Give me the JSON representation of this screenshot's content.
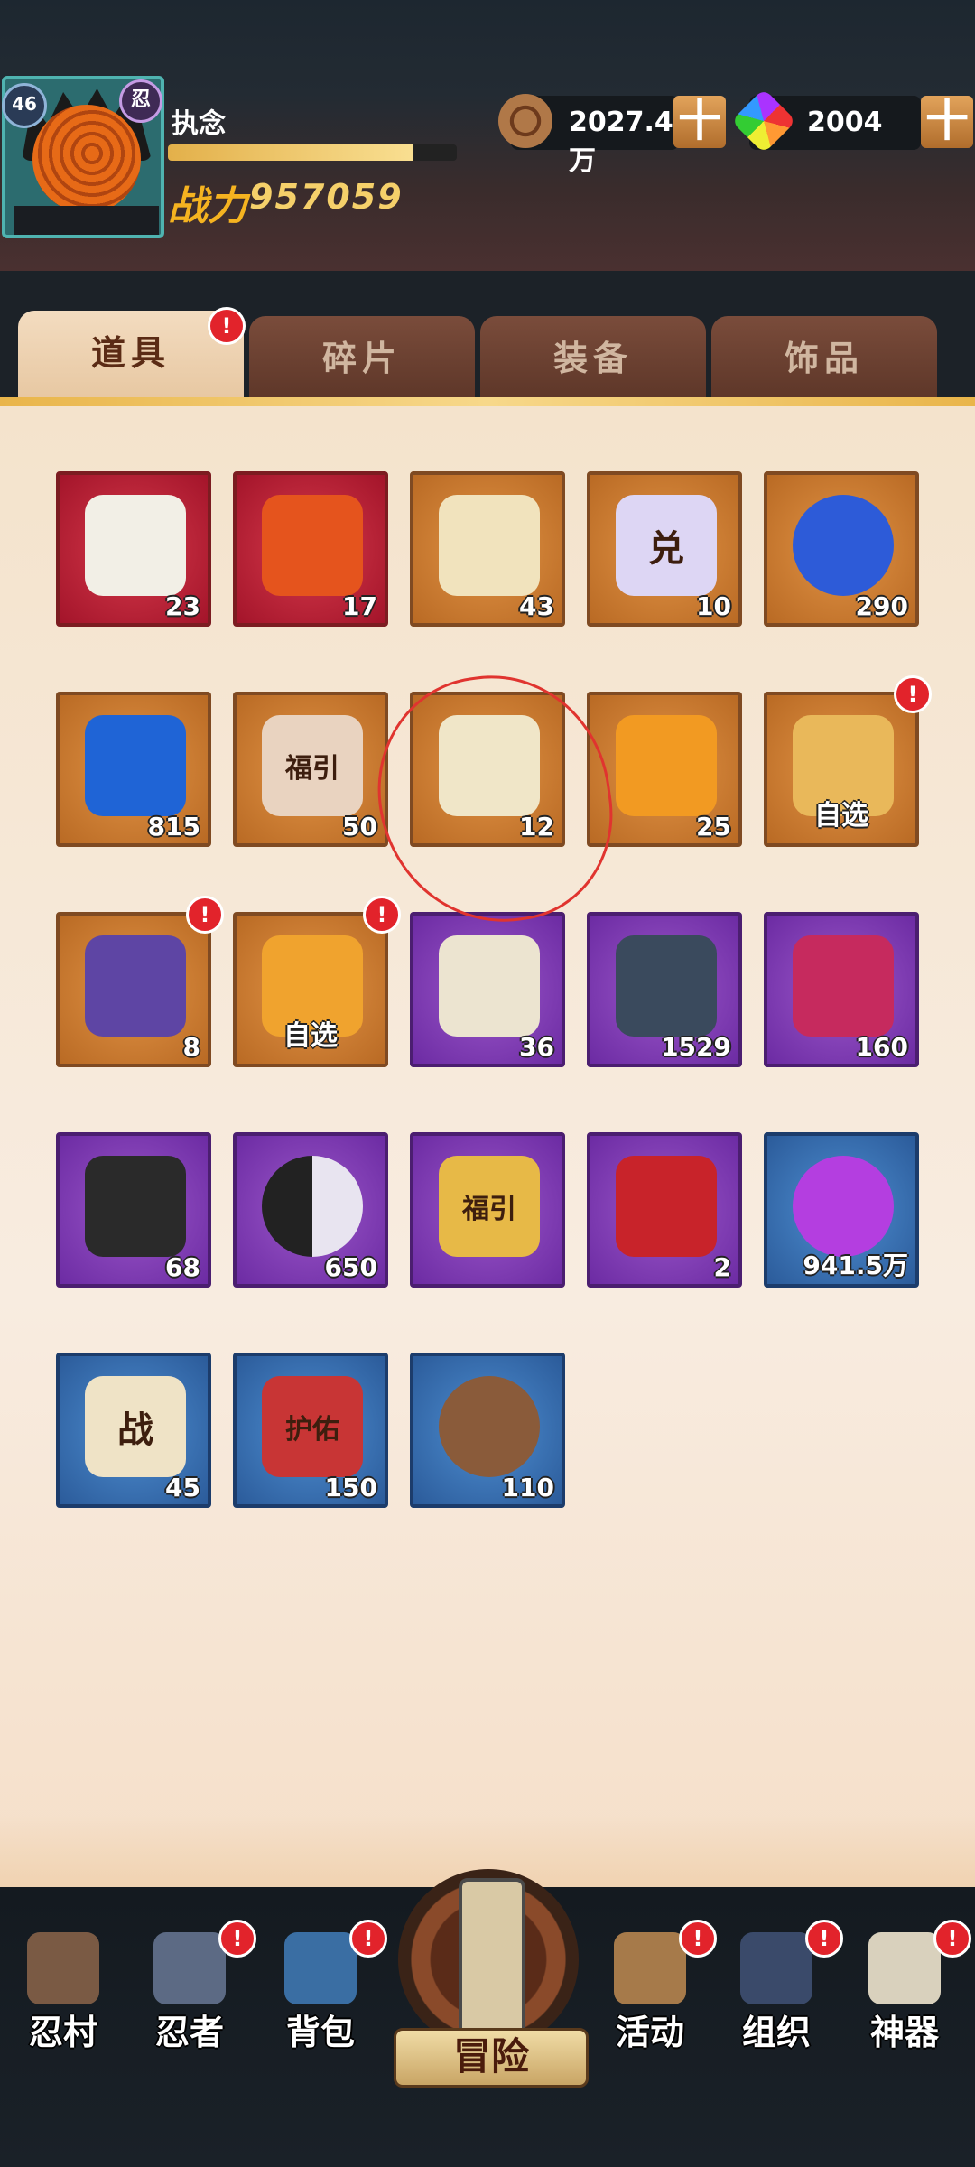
{
  "player": {
    "level": "46",
    "rank_icon": "忍",
    "name": "执念",
    "xp_fraction": 0.85,
    "power_label": "战力",
    "power_value": "957059"
  },
  "currency": {
    "coins": "2027.4万",
    "gems": "2004",
    "plus": "十"
  },
  "tabs": [
    {
      "label": "道具",
      "active": true,
      "badge": "!"
    },
    {
      "label": "碎片",
      "active": false
    },
    {
      "label": "装备",
      "active": false
    },
    {
      "label": "饰品",
      "active": false
    }
  ],
  "items": [
    {
      "icon": "scroll-bundle-icon",
      "rarity": "red",
      "count": "23"
    },
    {
      "icon": "flame-feather-icon",
      "rarity": "red",
      "count": "17"
    },
    {
      "icon": "gold-scroll-icon",
      "rarity": "orange",
      "count": "43"
    },
    {
      "icon": "exchange-card-icon",
      "rarity": "orange",
      "count": "10",
      "glyph": "兑"
    },
    {
      "icon": "blue-orb-icon",
      "rarity": "orange",
      "count": "290"
    },
    {
      "icon": "blue-moon-icon",
      "rarity": "orange",
      "count": "815"
    },
    {
      "icon": "fortune-ticket-icon",
      "rarity": "orange",
      "count": "50",
      "glyph": "福引"
    },
    {
      "icon": "summon-paper-icon",
      "rarity": "orange",
      "count": "12"
    },
    {
      "icon": "amber-gem-icon",
      "rarity": "orange",
      "count": "25"
    },
    {
      "icon": "select-chest-icon",
      "rarity": "orange",
      "select_label": "自选",
      "badge": "!"
    },
    {
      "icon": "purple-chest-icon",
      "rarity": "orange",
      "count": "8",
      "badge": "!"
    },
    {
      "icon": "gift-box-icon",
      "rarity": "orange",
      "select_label": "自选",
      "badge": "!"
    },
    {
      "icon": "blue-scroll-icon",
      "rarity": "purple",
      "count": "36"
    },
    {
      "icon": "upgrade-book-icon",
      "rarity": "purple",
      "count": "1529"
    },
    {
      "icon": "pink-jar-icon",
      "rarity": "purple",
      "count": "160"
    },
    {
      "icon": "black-ore-icon",
      "rarity": "purple",
      "count": "68"
    },
    {
      "icon": "yin-yang-icon",
      "rarity": "purple",
      "count": "650"
    },
    {
      "icon": "fortune-ticket-gold-icon",
      "rarity": "purple",
      "glyph": "福引"
    },
    {
      "icon": "medkit-icon",
      "rarity": "purple",
      "count": "2"
    },
    {
      "icon": "purple-orb-icon",
      "rarity": "blue",
      "count": "941.5万"
    },
    {
      "icon": "battle-scroll-icon",
      "rarity": "blue",
      "count": "45",
      "glyph": "战"
    },
    {
      "icon": "amulet-icon",
      "rarity": "blue",
      "count": "150",
      "glyph": "护佑"
    },
    {
      "icon": "bronze-coin-icon",
      "rarity": "blue",
      "count": "110"
    }
  ],
  "nav": [
    {
      "label": "忍村",
      "icon": "village-gate-icon",
      "badge": ""
    },
    {
      "label": "忍者",
      "icon": "ninja-head-icon",
      "badge": "!"
    },
    {
      "label": "背包",
      "icon": "backpack-icon",
      "badge": "!"
    },
    {
      "label": "冒险",
      "icon": "adventure-scroll-icon",
      "badge": ""
    },
    {
      "label": "活动",
      "icon": "drum-icon",
      "badge": "!"
    },
    {
      "label": "组织",
      "icon": "team-icon",
      "badge": "!"
    },
    {
      "label": "神器",
      "icon": "artifact-scroll-icon",
      "badge": "!"
    }
  ],
  "colors": {
    "accent": "#e9b54a",
    "badge": "#e2232b",
    "annotation": "#e0342f"
  }
}
